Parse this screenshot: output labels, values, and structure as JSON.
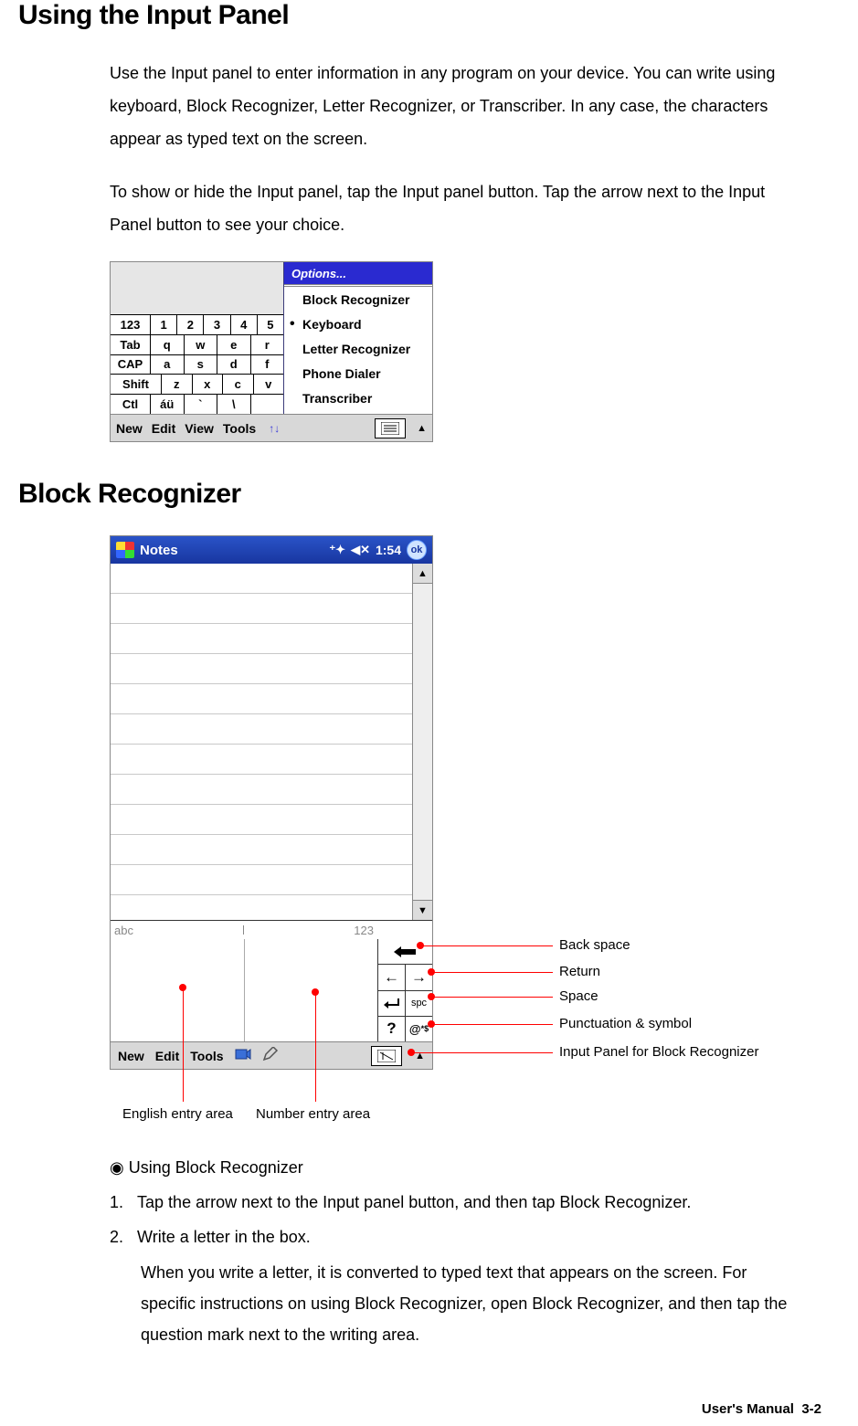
{
  "heading1": "Using the Input Panel",
  "para1": "Use the Input panel to enter information in any program on your device. You can write using keyboard, Block Recognizer, Letter Recognizer, or Transcriber. In any case, the characters appear as typed text on the screen.",
  "para2": "To show or hide the Input panel, tap the Input panel button. Tap the arrow next to the Input Panel button to see your choice.",
  "shot1": {
    "options_label": "Options...",
    "menu": {
      "block": "Block Recognizer",
      "keyboard": "Keyboard",
      "letter": "Letter Recognizer",
      "phone": "Phone Dialer",
      "transcriber": "Transcriber"
    },
    "kb": {
      "r1": [
        "123",
        "1",
        "2",
        "3",
        "4",
        "5"
      ],
      "r2": [
        "Tab",
        "q",
        "w",
        "e",
        "r"
      ],
      "r3": [
        "CAP",
        "a",
        "s",
        "d",
        "f"
      ],
      "r4": [
        "Shift",
        "z",
        "x",
        "c",
        "v"
      ],
      "r5": [
        "Ctl",
        "áü",
        "`",
        "\\"
      ]
    },
    "toolbar": {
      "new": "New",
      "edit": "Edit",
      "view": "View",
      "tools": "Tools"
    }
  },
  "heading2": "Block Recognizer",
  "shot2": {
    "title": "Notes",
    "time": "1:54",
    "ok": "ok",
    "abc": "abc",
    "n123": "123",
    "spc": "spc",
    "toolbar": {
      "new": "New",
      "edit": "Edit",
      "tools": "Tools"
    }
  },
  "callouts": {
    "backspace": "Back space",
    "return": "Return",
    "space": "Space",
    "punct": "Punctuation & symbol",
    "panel": "Input Panel for Block Recognizer",
    "english": "English entry area",
    "number": "Number entry area"
  },
  "usage": {
    "bullet": "Using Block Recognizer",
    "step1_num": "1.",
    "step1": "Tap the arrow next to the Input panel button, and then tap Block Recognizer.",
    "step2_num": "2.",
    "step2": "Write a letter in the box.",
    "step2_body": "When you write a letter, it is converted to typed text that appears on the screen. For specific instructions on using Block Recognizer, open Block Recognizer, and then tap the question mark next to the writing area."
  },
  "footer_label": "User's Manual",
  "footer_page": "3-2"
}
